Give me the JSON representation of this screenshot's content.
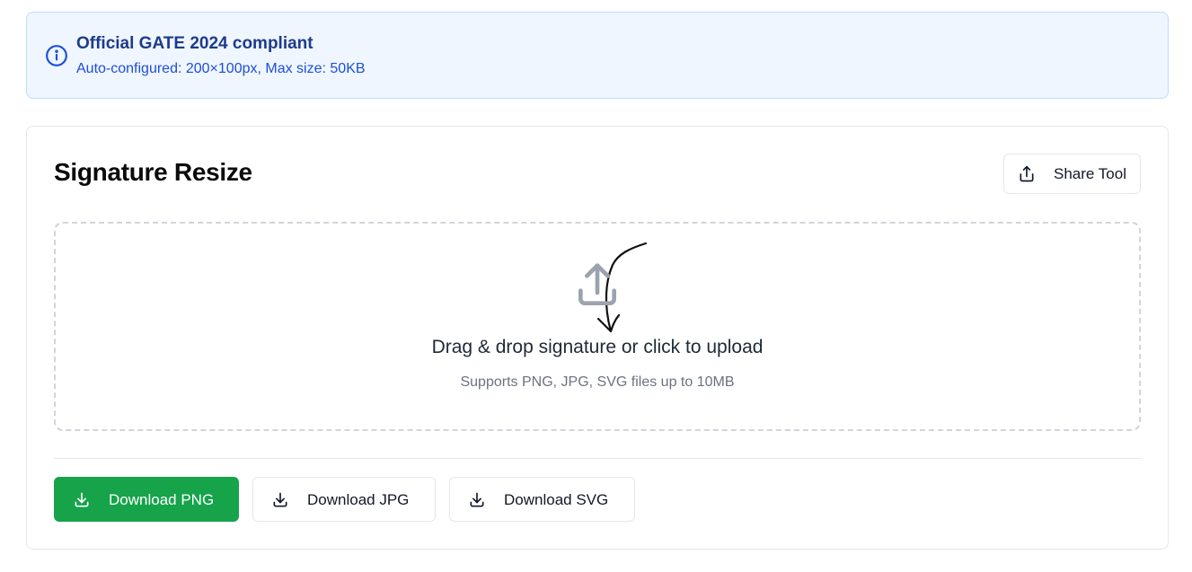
{
  "notice": {
    "title": "Official GATE 2024 compliant",
    "subtitle": "Auto-configured: 200×100px, Max size: 50KB",
    "icon": "info-icon",
    "accent_color": "#1d4ed8"
  },
  "card": {
    "title": "Signature Resize",
    "share_button": {
      "label": "Share Tool",
      "icon": "share-icon"
    }
  },
  "dropzone": {
    "icon": "upload-icon",
    "title": "Drag & drop signature or click to upload",
    "subtitle": "Supports PNG, JPG, SVG files up to 10MB"
  },
  "downloads": [
    {
      "label": "Download PNG",
      "icon": "download-icon",
      "color": "#16a34a"
    },
    {
      "label": "Download JPG",
      "icon": "download-icon"
    },
    {
      "label": "Download SVG",
      "icon": "download-icon"
    }
  ]
}
